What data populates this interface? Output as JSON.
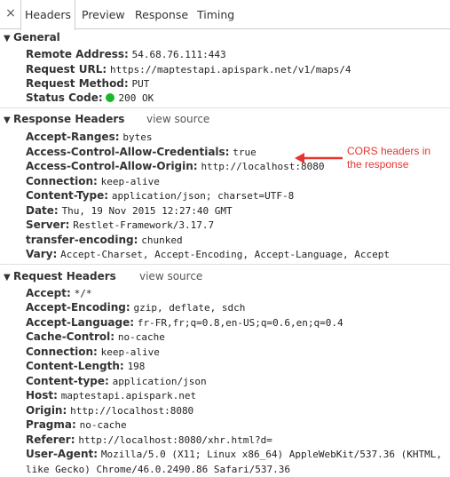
{
  "tabs": [
    {
      "label": "Headers",
      "active": true
    },
    {
      "label": "Preview",
      "active": false
    },
    {
      "label": "Response",
      "active": false
    },
    {
      "label": "Timing",
      "active": false
    }
  ],
  "close_icon": "×",
  "general": {
    "title": "General",
    "rows": [
      {
        "key": "Remote Address:",
        "value": "54.68.76.111:443"
      },
      {
        "key": "Request URL:",
        "value": "https://maptestapi.apispark.net/v1/maps/4"
      },
      {
        "key": "Request Method:",
        "value": "PUT"
      },
      {
        "key": "Status Code:",
        "value": "200 OK",
        "status_color": "#19b82a"
      }
    ]
  },
  "response_headers": {
    "title": "Response Headers",
    "view_source": "view source",
    "rows": [
      {
        "key": "Accept-Ranges:",
        "value": "bytes"
      },
      {
        "key": "Access-Control-Allow-Credentials:",
        "value": "true"
      },
      {
        "key": "Access-Control-Allow-Origin:",
        "value": "http://localhost:8080"
      },
      {
        "key": "Connection:",
        "value": "keep-alive"
      },
      {
        "key": "Content-Type:",
        "value": "application/json; charset=UTF-8"
      },
      {
        "key": "Date:",
        "value": "Thu, 19 Nov 2015 12:27:40 GMT"
      },
      {
        "key": "Server:",
        "value": "Restlet-Framework/3.17.7"
      },
      {
        "key": "transfer-encoding:",
        "value": "chunked"
      },
      {
        "key": "Vary:",
        "value": "Accept-Charset, Accept-Encoding, Accept-Language, Accept"
      }
    ]
  },
  "request_headers": {
    "title": "Request Headers",
    "view_source": "view source",
    "rows": [
      {
        "key": "Accept:",
        "value": "*/*"
      },
      {
        "key": "Accept-Encoding:",
        "value": "gzip, deflate, sdch"
      },
      {
        "key": "Accept-Language:",
        "value": "fr-FR,fr;q=0.8,en-US;q=0.6,en;q=0.4"
      },
      {
        "key": "Cache-Control:",
        "value": "no-cache"
      },
      {
        "key": "Connection:",
        "value": "keep-alive"
      },
      {
        "key": "Content-Length:",
        "value": "198"
      },
      {
        "key": "Content-type:",
        "value": "application/json"
      },
      {
        "key": "Host:",
        "value": "maptestapi.apispark.net"
      },
      {
        "key": "Origin:",
        "value": "http://localhost:8080"
      },
      {
        "key": "Pragma:",
        "value": "no-cache"
      },
      {
        "key": "Referer:",
        "value": "http://localhost:8080/xhr.html?d="
      },
      {
        "key": "User-Agent:",
        "value": "Mozilla/5.0 (X11; Linux x86_64) AppleWebKit/537.36 (KHTML, like Gecko) Chrome/46.0.2490.86 Safari/537.36"
      }
    ]
  },
  "annotation": {
    "text": "CORS headers in the response",
    "color": "#e8332f"
  }
}
